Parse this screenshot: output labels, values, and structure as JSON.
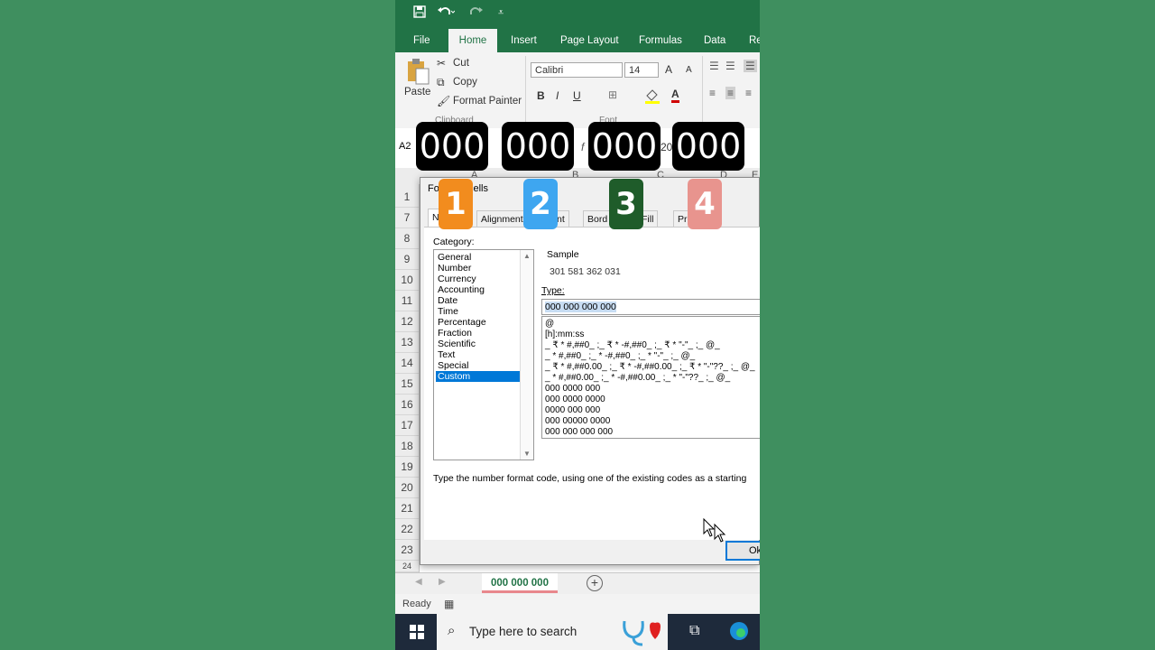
{
  "quick_access": {
    "save_icon": "save-icon",
    "undo_icon": "undo-icon",
    "redo_icon": "redo-icon",
    "customize_icon": "customize-qat-icon"
  },
  "ribbon_tabs": [
    "File",
    "Home",
    "Insert",
    "Page Layout",
    "Formulas",
    "Data",
    "Re"
  ],
  "ribbon": {
    "paste_label": "Paste",
    "cut_label": "Cut",
    "copy_label": "Copy",
    "format_painter_label": "Format Painter",
    "clipboard_group": "Clipboard",
    "font_group": "Font",
    "font_name": "Calibri",
    "font_size": "14",
    "bold": "B",
    "italic": "I",
    "underline": "U",
    "grow_font": "A",
    "shrink_font": "A",
    "font_color": "A"
  },
  "formula_bar": {
    "name_box": "A2",
    "fx": "f",
    "value_fragment": "20"
  },
  "columns": [
    "A",
    "B",
    "C",
    "D",
    "E"
  ],
  "rows": [
    "1",
    "7",
    "8",
    "9",
    "10",
    "11",
    "12",
    "13",
    "14",
    "15",
    "16",
    "17",
    "18",
    "19",
    "20",
    "21",
    "22",
    "23",
    "24"
  ],
  "dialog": {
    "title": "Format Cells",
    "title_visible": "For",
    "title_visible2": "ells",
    "tabs": [
      "Nu",
      "Alignment",
      "nt",
      "Bord",
      "Fill",
      "Pro"
    ],
    "category_label": "Category:",
    "categories": [
      "General",
      "Number",
      "Currency",
      "Accounting",
      "Date",
      "Time",
      "Percentage",
      "Fraction",
      "Scientific",
      "Text",
      "Special",
      "Custom"
    ],
    "selected_category": "Custom",
    "sample_label": "Sample",
    "sample_value": "301 581 362 031",
    "type_label": "Type:",
    "type_value": "000 000 000 000",
    "formats": [
      "@",
      "[h]:mm:ss",
      "_ ₹ * #,##0_ ;_ ₹ * -#,##0_ ;_ ₹ * \"-\"_ ;_ @_",
      "_ * #,##0_ ;_ * -#,##0_ ;_ * \"-\"_ ;_ @_",
      "_ ₹ * #,##0.00_ ;_ ₹ * -#,##0.00_ ;_ ₹ * \"-\"??_ ;_ @_",
      "_ * #,##0.00_ ;_ * -#,##0.00_ ;_ * \"-\"??_ ;_ @_",
      "000 0000 000",
      "000 0000 0000",
      "0000 000 000",
      "000 00000 0000",
      "000 000 000 000"
    ],
    "hint": "Type the number format code, using one of the existing codes as a starting",
    "ok_label": "Ok"
  },
  "sheet_tab": "000 000 000",
  "status": {
    "ready": "Ready"
  },
  "taskbar": {
    "search_placeholder": "Type here to search"
  },
  "overlay": {
    "groups": [
      "000",
      "000",
      "000",
      "000"
    ],
    "badges": [
      "1",
      "2",
      "3",
      "4"
    ],
    "badge_colors": [
      "#f28c1e",
      "#3ea6f0",
      "#1f5c2a",
      "#e8948e"
    ]
  },
  "colors": {
    "excel_green": "#217346",
    "background": "#3f8f5f",
    "selection_blue": "#0078d7"
  }
}
